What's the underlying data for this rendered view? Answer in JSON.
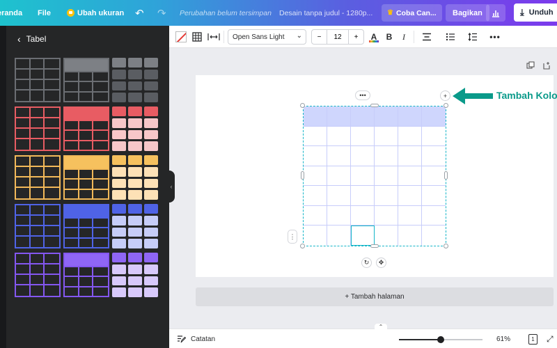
{
  "header": {
    "home_label": "eranda",
    "file_label": "File",
    "resize_label": "Ubah ukuran",
    "undo_icon": "undo-icon",
    "redo_icon": "redo-icon",
    "unsaved_status": "Perubahan belum tersimpan",
    "design_title": "Desain tanpa judul - 1280p...",
    "try_label": "Coba Can...",
    "share_label": "Bagikan",
    "download_label": "Unduh",
    "gradient_colors": [
      "#1ec2ce",
      "#5a5fe0",
      "#7c3aed"
    ]
  },
  "side_panel": {
    "back_icon": "chevron-left-icon",
    "title": "Tabel",
    "rows": [
      {
        "color": "#6b6e73",
        "styles": [
          "grid",
          "header",
          "blocks"
        ],
        "block_color": "#5a5d62",
        "header_color": "#7d8085"
      },
      {
        "color": "#e85c63",
        "styles": [
          "grid",
          "header",
          "blocks"
        ],
        "block_color": "#f7c7c9",
        "header_color": "#e85c63"
      },
      {
        "color": "#f2b959",
        "styles": [
          "grid",
          "header",
          "blocks"
        ],
        "block_color": "#fde1b6",
        "header_color": "#f6c15e"
      },
      {
        "color": "#4f63e6",
        "styles": [
          "grid",
          "header",
          "blocks"
        ],
        "block_color": "#c6cdf8",
        "header_color": "#4f63e6"
      },
      {
        "color": "#8457f0",
        "styles": [
          "grid",
          "header",
          "blocks"
        ],
        "block_color": "#d8c9fb",
        "header_color": "#8f66f5"
      }
    ]
  },
  "toolbar": {
    "font_name": "Open Sans Light",
    "font_size": "12",
    "minus": "−",
    "plus": "+",
    "text_color_letter": "A",
    "bold": "B",
    "italic": "I",
    "more": "•••"
  },
  "canvas": {
    "add_page_label": "+ Tambah halaman",
    "annotation": "Tambah Kolom",
    "table_rows": 7,
    "table_cols": 6,
    "accent": "#13b5c8",
    "annotation_color": "#0a9a8a"
  },
  "bottom_bar": {
    "notes_label": "Catatan",
    "zoom": "61%",
    "zoom_level": 0.5,
    "page_count": "1"
  }
}
